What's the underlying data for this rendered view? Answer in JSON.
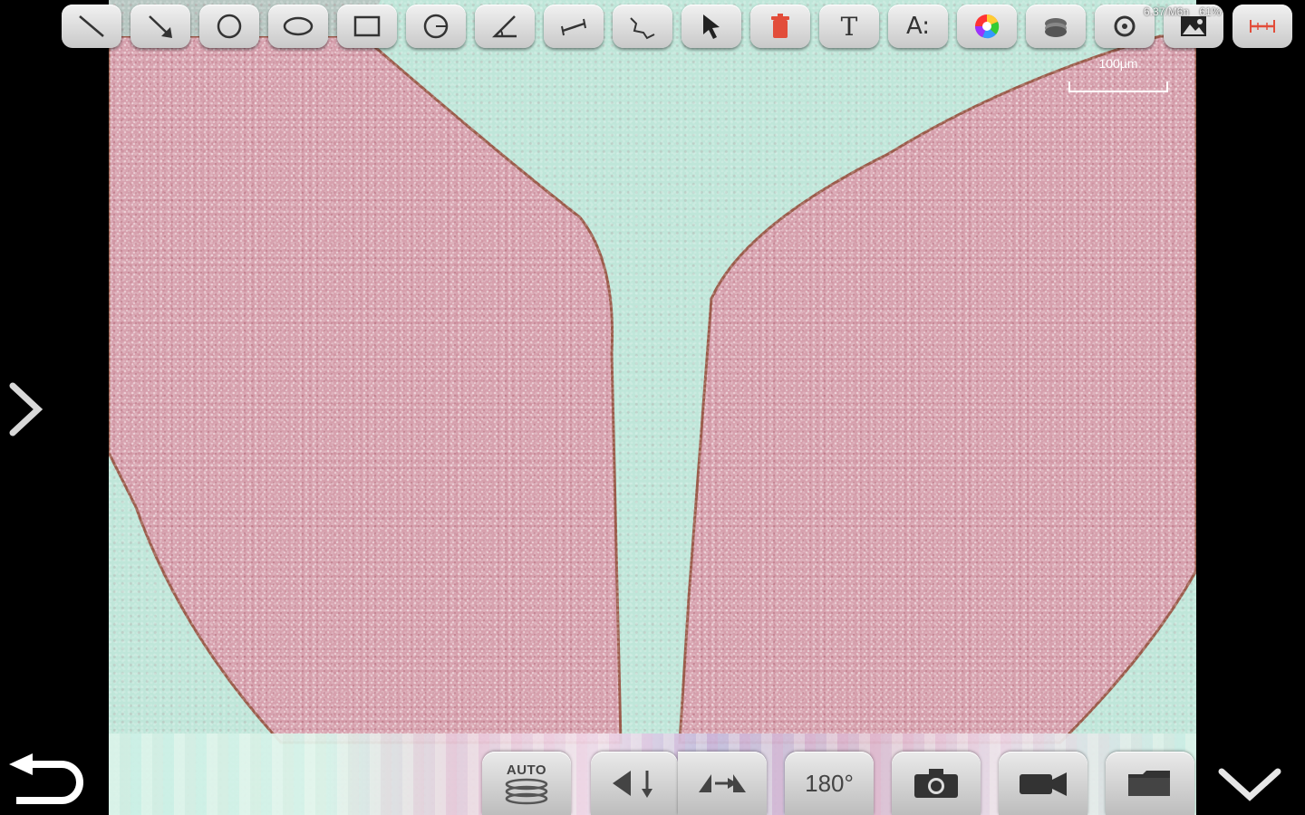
{
  "toolbar": {
    "tools": [
      {
        "name": "line-tool",
        "icon": "line-icon"
      },
      {
        "name": "arrow-tool",
        "icon": "arrow-icon"
      },
      {
        "name": "circle-tool",
        "icon": "circle-icon"
      },
      {
        "name": "ellipse-tool",
        "icon": "ellipse-icon"
      },
      {
        "name": "rectangle-tool",
        "icon": "rectangle-icon"
      },
      {
        "name": "circle-radius-tool",
        "icon": "circle-radius-icon"
      },
      {
        "name": "angle-tool",
        "icon": "angle-icon"
      },
      {
        "name": "dimension-tool",
        "icon": "dimension-icon"
      },
      {
        "name": "polyline-tool",
        "icon": "polyline-icon"
      },
      {
        "name": "select-tool",
        "icon": "cursor-icon"
      },
      {
        "name": "delete-tool",
        "icon": "trash-icon"
      },
      {
        "name": "text-tool",
        "icon": "text-icon",
        "label": "T"
      },
      {
        "name": "font-tool",
        "icon": "font-icon",
        "label": "A:"
      },
      {
        "name": "color-tool",
        "icon": "color-wheel-icon"
      },
      {
        "name": "layers-tool",
        "icon": "layers-icon"
      },
      {
        "name": "settings-tool",
        "icon": "gear-icon"
      },
      {
        "name": "image-tool",
        "icon": "image-icon"
      },
      {
        "name": "calibration-tool",
        "icon": "ruler-icon"
      }
    ]
  },
  "hud": {
    "capacity": "6.37/M6n",
    "battery": "61%"
  },
  "scale": {
    "label": "100µm"
  },
  "bottom": {
    "auto_label": "AUTO",
    "rotate_label": "180°"
  },
  "colors": {
    "tissue": "#d9a6b0",
    "background": "#bfe6d9",
    "delete_red": "#e24d3a"
  }
}
